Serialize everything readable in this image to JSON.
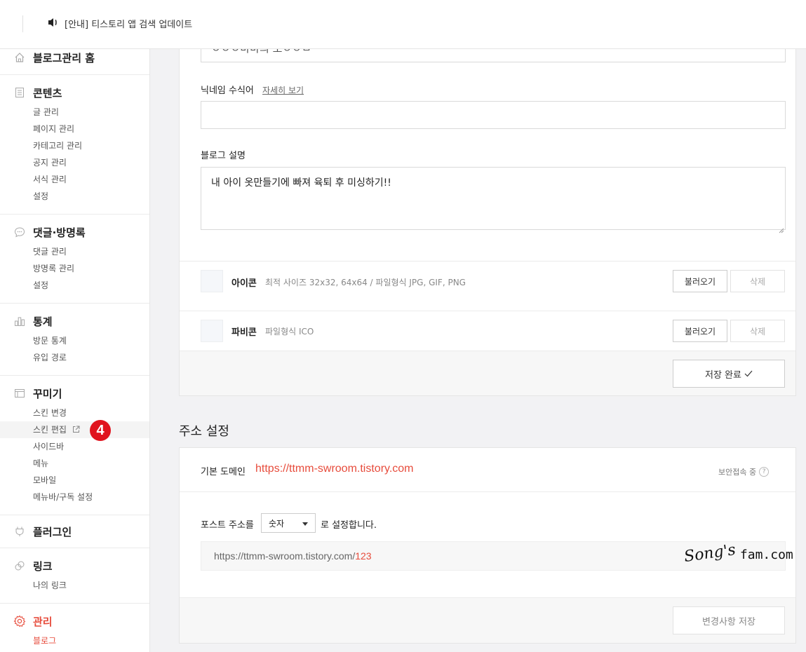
{
  "topbar": {
    "notice_text": "[안내] 티스토리 앱 검색 업데이트"
  },
  "sidebar": {
    "home": "블로그관리 홈",
    "contents": {
      "title": "콘텐츠",
      "items": [
        "글 관리",
        "페이지 관리",
        "카테고리 관리",
        "공지 관리",
        "서식 관리",
        "설정"
      ]
    },
    "comments": {
      "title": "댓글·방명록",
      "items": [
        "댓글 관리",
        "방명록 관리",
        "설정"
      ]
    },
    "stats": {
      "title": "통계",
      "items": [
        "방문 통계",
        "유입 경로"
      ]
    },
    "design": {
      "title": "꾸미기",
      "items": [
        "스킨 변경",
        "스킨 편집",
        "사이드바",
        "메뉴",
        "모바일",
        "메뉴바/구독 설정"
      ],
      "step_badge": "4"
    },
    "plugin": {
      "title": "플러그인"
    },
    "link": {
      "title": "링크",
      "items": [
        "나의 링크"
      ]
    },
    "manage": {
      "title": "관리",
      "items": [
        "블로그"
      ]
    }
  },
  "blog_settings": {
    "name_value": "ㅇㅇㅇ바바의 오ㅇㅇㅁ",
    "nickname_label": "닉네임 수식어",
    "nickname_link": "자세히 보기",
    "nickname_value": "",
    "desc_label": "블로그 설명",
    "desc_value": "내 아이 옷만들기에 빠져 육퇴 후 미싱하기!!",
    "icon": {
      "title": "아이콘",
      "desc": "최적 사이즈 32x32, 64x64 / 파일형식 JPG, GIF, PNG",
      "load": "불러오기",
      "delete": "삭제"
    },
    "favicon": {
      "title": "파비콘",
      "desc": "파일형식 ICO",
      "load": "불러오기",
      "delete": "삭제"
    },
    "save_done": "저장 완료"
  },
  "address": {
    "section_title": "주소 설정",
    "default_domain_label": "기본 도메인",
    "default_domain": "https://ttmm-swroom.tistory.com",
    "secure": "보안접속 중",
    "post_addr_label": "포스트 주소를",
    "post_addr_select": "숫자",
    "post_addr_suffix": "로 설정합니다.",
    "url_prefix": "https://ttmm-swroom.tistory.com/",
    "url_suffix": "123",
    "save_changes": "변경사항 저장"
  },
  "watermark": {
    "script": "Song's",
    "text": "fam.com"
  },
  "colors": {
    "accent": "#e74c3c",
    "badge": "#e0141e"
  }
}
